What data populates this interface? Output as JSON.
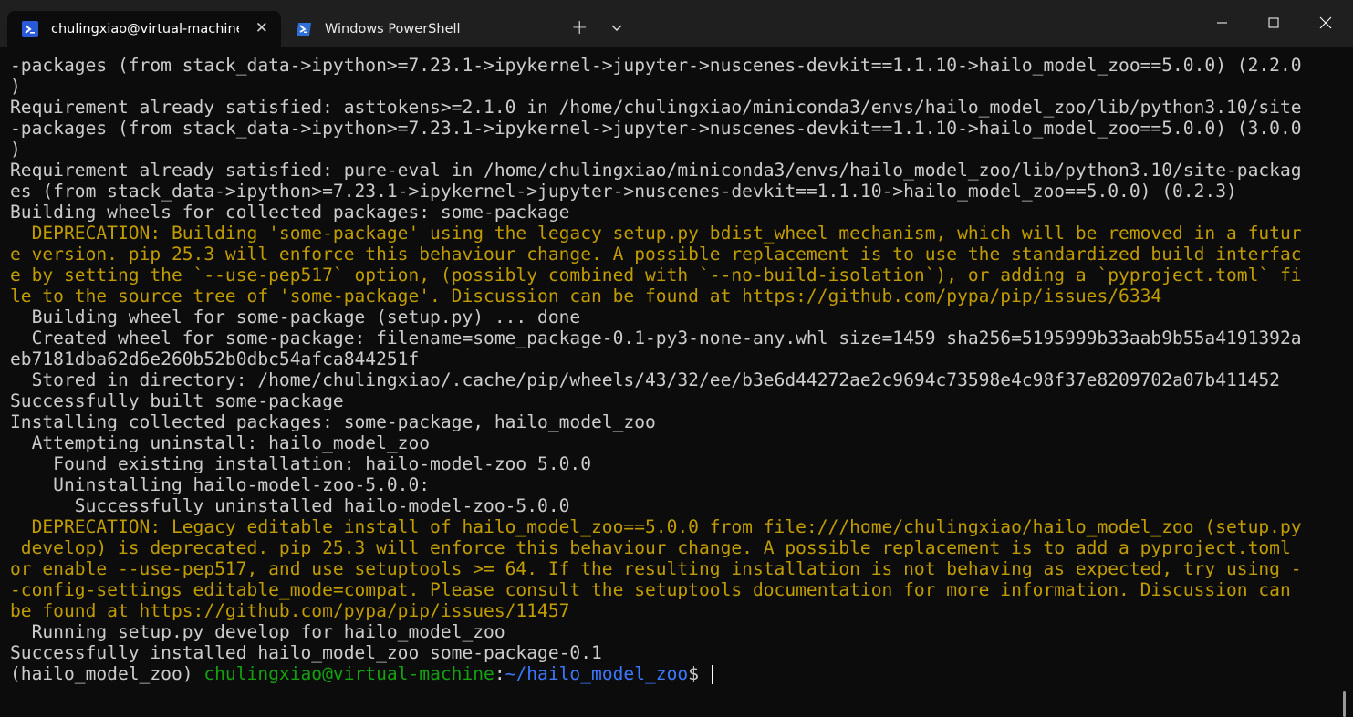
{
  "tabs": [
    {
      "title": "chulingxiao@virtual-machine:",
      "icon": "terminal-icon",
      "active": true
    },
    {
      "title": "Windows PowerShell",
      "icon": "powershell-icon",
      "active": false
    }
  ],
  "controls": {
    "new_tab": "+",
    "close_tab": "✕"
  },
  "colors": {
    "warning": "#c19c00",
    "user": "#13a10e",
    "path": "#3b78ff",
    "text": "#cccccc",
    "background": "#0c0c0c"
  },
  "lines": [
    {
      "t": "-packages (from stack_data->ipython>=7.23.1->ipykernel->jupyter->nuscenes-devkit==1.1.10->hailo_model_zoo==5.0.0) (2.2.0",
      "s": "normal"
    },
    {
      "t": ")",
      "s": "normal"
    },
    {
      "t": "Requirement already satisfied: asttokens>=2.1.0 in /home/chulingxiao/miniconda3/envs/hailo_model_zoo/lib/python3.10/site",
      "s": "normal"
    },
    {
      "t": "-packages (from stack_data->ipython>=7.23.1->ipykernel->jupyter->nuscenes-devkit==1.1.10->hailo_model_zoo==5.0.0) (3.0.0",
      "s": "normal"
    },
    {
      "t": ")",
      "s": "normal"
    },
    {
      "t": "Requirement already satisfied: pure-eval in /home/chulingxiao/miniconda3/envs/hailo_model_zoo/lib/python3.10/site-packag",
      "s": "normal"
    },
    {
      "t": "es (from stack_data->ipython>=7.23.1->ipykernel->jupyter->nuscenes-devkit==1.1.10->hailo_model_zoo==5.0.0) (0.2.3)",
      "s": "normal"
    },
    {
      "t": "Building wheels for collected packages: some-package",
      "s": "normal"
    },
    {
      "t": "  DEPRECATION: Building 'some-package' using the legacy setup.py bdist_wheel mechanism, which will be removed in a futur",
      "s": "warn"
    },
    {
      "t": "e version. pip 25.3 will enforce this behaviour change. A possible replacement is to use the standardized build interfac",
      "s": "warn"
    },
    {
      "t": "e by setting the `--use-pep517` option, (possibly combined with `--no-build-isolation`), or adding a `pyproject.toml` fi",
      "s": "warn"
    },
    {
      "t": "le to the source tree of 'some-package'. Discussion can be found at https://github.com/pypa/pip/issues/6334",
      "s": "warn"
    },
    {
      "t": "  Building wheel for some-package (setup.py) ... done",
      "s": "normal"
    },
    {
      "t": "  Created wheel for some-package: filename=some_package-0.1-py3-none-any.whl size=1459 sha256=5195999b33aab9b55a4191392a",
      "s": "normal"
    },
    {
      "t": "eb7181dba62d6e260b52b0dbc54afca844251f",
      "s": "normal"
    },
    {
      "t": "  Stored in directory: /home/chulingxiao/.cache/pip/wheels/43/32/ee/b3e6d44272ae2c9694c73598e4c98f37e8209702a07b411452",
      "s": "normal"
    },
    {
      "t": "Successfully built some-package",
      "s": "normal"
    },
    {
      "t": "Installing collected packages: some-package, hailo_model_zoo",
      "s": "normal"
    },
    {
      "t": "  Attempting uninstall: hailo_model_zoo",
      "s": "normal"
    },
    {
      "t": "    Found existing installation: hailo-model-zoo 5.0.0",
      "s": "normal"
    },
    {
      "t": "    Uninstalling hailo-model-zoo-5.0.0:",
      "s": "normal"
    },
    {
      "t": "      Successfully uninstalled hailo-model-zoo-5.0.0",
      "s": "normal"
    },
    {
      "t": "  DEPRECATION: Legacy editable install of hailo_model_zoo==5.0.0 from file:///home/chulingxiao/hailo_model_zoo (setup.py",
      "s": "warn"
    },
    {
      "t": " develop) is deprecated. pip 25.3 will enforce this behaviour change. A possible replacement is to add a pyproject.toml",
      "s": "warn"
    },
    {
      "t": "or enable --use-pep517, and use setuptools >= 64. If the resulting installation is not behaving as expected, try using -",
      "s": "warn"
    },
    {
      "t": "-config-settings editable_mode=compat. Please consult the setuptools documentation for more information. Discussion can",
      "s": "warn"
    },
    {
      "t": "be found at https://github.com/pypa/pip/issues/11457",
      "s": "warn"
    },
    {
      "t": "  Running setup.py develop for hailo_model_zoo",
      "s": "normal"
    },
    {
      "t": "Successfully installed hailo_model_zoo some-package-0.1",
      "s": "normal"
    }
  ],
  "prompt": {
    "env": "(hailo_model_zoo) ",
    "user": "chulingxiao@virtual-machine",
    "sep": ":",
    "path": "~/hailo_model_zoo",
    "symbol": "$"
  }
}
